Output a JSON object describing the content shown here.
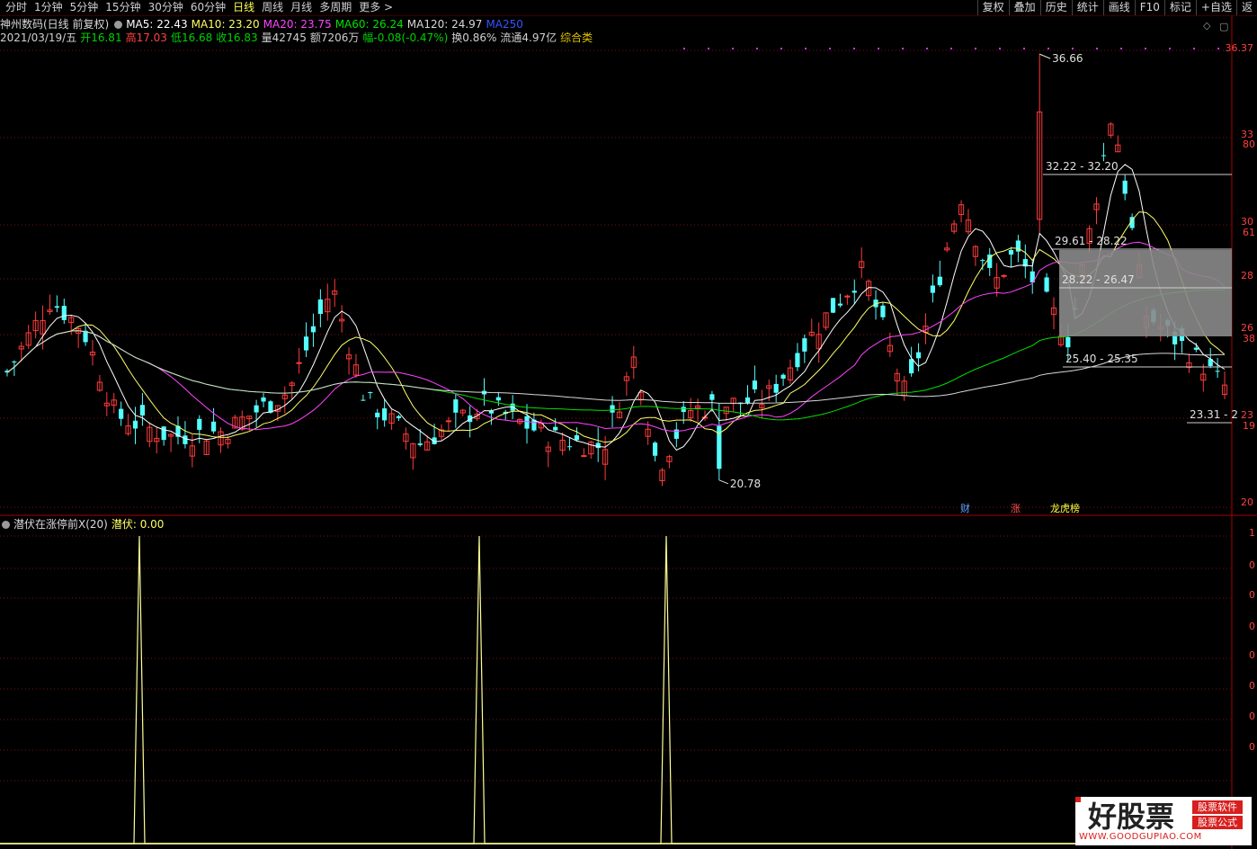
{
  "toolbar": {
    "periods": [
      "分时",
      "1分钟",
      "5分钟",
      "15分钟",
      "30分钟",
      "60分钟",
      "日线",
      "周线",
      "月线",
      "多周期",
      "更多 >"
    ],
    "active_period": "日线",
    "right_buttons": [
      "复权",
      "叠加",
      "历史",
      "统计",
      "画线",
      "F10",
      "标记",
      "+自选",
      "返"
    ]
  },
  "info_line1": {
    "title": "神州数码(日线 前复权)",
    "ma": [
      {
        "label": "MA5: 22.43",
        "color": "#ffffff"
      },
      {
        "label": "MA10: 23.20",
        "color": "#ffff66"
      },
      {
        "label": "MA20: 23.75",
        "color": "#ff44ff"
      },
      {
        "label": "MA60: 26.24",
        "color": "#00e000"
      },
      {
        "label": "MA120: 24.97",
        "color": "#d8d8d8"
      },
      {
        "label": "MA250",
        "color": "#3355ff"
      }
    ]
  },
  "info_line2": [
    {
      "text": "2021/03/19/五",
      "color": "#d0d0d0"
    },
    {
      "text": "开16.81",
      "color": "#00d000"
    },
    {
      "text": "高17.03",
      "color": "#ff4040"
    },
    {
      "text": "低16.68",
      "color": "#00d000"
    },
    {
      "text": "收16.83",
      "color": "#00d000"
    },
    {
      "text": "量42745",
      "color": "#d0d0d0"
    },
    {
      "text": "额7206万",
      "color": "#d0d0d0"
    },
    {
      "text": "幅-0.08(-0.47%)",
      "color": "#00d000"
    },
    {
      "text": "换0.86%",
      "color": "#d0d0d0"
    },
    {
      "text": "流通4.97亿",
      "color": "#d0d0d0"
    },
    {
      "text": "综合类",
      "color": "#e0c000"
    }
  ],
  "price_axis": [
    "36.37",
    "33",
    "30",
    "28",
    "26",
    "23",
    "20"
  ],
  "price_axis_secondary": [
    "80",
    "61",
    "38",
    "19"
  ],
  "annotations": {
    "high": "36.66",
    "low": "20.78",
    "level1": "32.22 - 32.20",
    "level2": "29.61 - 28.22",
    "level3": "28.22 - 26.47",
    "level4": "25.40 - 25.35",
    "level5": "23.31 - 2"
  },
  "event_tags": [
    {
      "text": "财",
      "color": "#5aa8ff"
    },
    {
      "text": "涨",
      "color": "#ff5050"
    },
    {
      "text": "龙虎榜",
      "color": "#ffff40"
    }
  ],
  "indicator": {
    "title": "潜伏在涨停前X(20)",
    "value_label": "潜伏: 0.00",
    "axis": [
      "1",
      "0",
      "0",
      "0",
      "0",
      "0",
      "0",
      "0"
    ]
  },
  "watermark": {
    "main": "好股票",
    "sub1": "股票软件",
    "sub2": "股票公式",
    "url": "WWW.GOODGUPIAO.COM"
  },
  "colors": {
    "up": "#ff3b3b",
    "down": "#54ffff",
    "ma5": "#ffffff",
    "ma10": "#ffff66",
    "ma20": "#ff44ff",
    "ma60": "#00e000",
    "ma120": "#d8d8d8",
    "signal": "#ffff99"
  },
  "chart_data": {
    "type": "candlestick",
    "price_range": [
      19.5,
      37.0
    ],
    "indicator_range": [
      0,
      1
    ],
    "signal_spikes_index": [
      31,
      109,
      151
    ],
    "candles_ohlc": [
      [
        24.6,
        25.2,
        24.3,
        25.0
      ],
      [
        25.0,
        27.1,
        24.8,
        26.9
      ],
      [
        26.9,
        27.4,
        26.6,
        27.2
      ],
      [
        27.2,
        27.8,
        26.4,
        26.5
      ],
      [
        26.5,
        27.7,
        26.3,
        27.6
      ],
      [
        27.6,
        27.9,
        27.1,
        27.3
      ],
      [
        27.3,
        27.6,
        26.9,
        27.2
      ],
      [
        27.2,
        27.5,
        26.8,
        27.0
      ],
      [
        27.0,
        27.9,
        26.7,
        27.8
      ],
      [
        27.8,
        27.9,
        26.3,
        26.4
      ],
      [
        26.4,
        26.5,
        25.7,
        25.8
      ],
      [
        25.8,
        26.0,
        24.7,
        24.8
      ],
      [
        24.8,
        25.1,
        24.1,
        24.2
      ],
      [
        24.2,
        24.6,
        23.8,
        24.0
      ],
      [
        24.0,
        24.2,
        23.2,
        23.3
      ],
      [
        23.3,
        23.5,
        22.5,
        22.6
      ],
      [
        22.6,
        23.0,
        22.3,
        22.5
      ],
      [
        22.5,
        23.7,
        22.4,
        23.6
      ],
      [
        23.6,
        23.8,
        22.9,
        23.0
      ],
      [
        23.0,
        23.1,
        22.2,
        22.3
      ],
      [
        22.3,
        22.5,
        22.0,
        22.2
      ],
      [
        22.2,
        22.4,
        21.9,
        22.3
      ],
      [
        22.3,
        24.3,
        22.2,
        24.2
      ],
      [
        24.2,
        24.5,
        23.7,
        24.4
      ],
      [
        24.4,
        24.6,
        23.6,
        23.8
      ],
      [
        23.8,
        24.1,
        23.3,
        23.5
      ],
      [
        23.5,
        23.8,
        22.8,
        22.9
      ],
      [
        22.9,
        23.2,
        22.6,
        23.1
      ],
      [
        23.1,
        23.4,
        22.7,
        22.8
      ],
      [
        22.8,
        23.0,
        22.4,
        22.6
      ]
    ]
  }
}
